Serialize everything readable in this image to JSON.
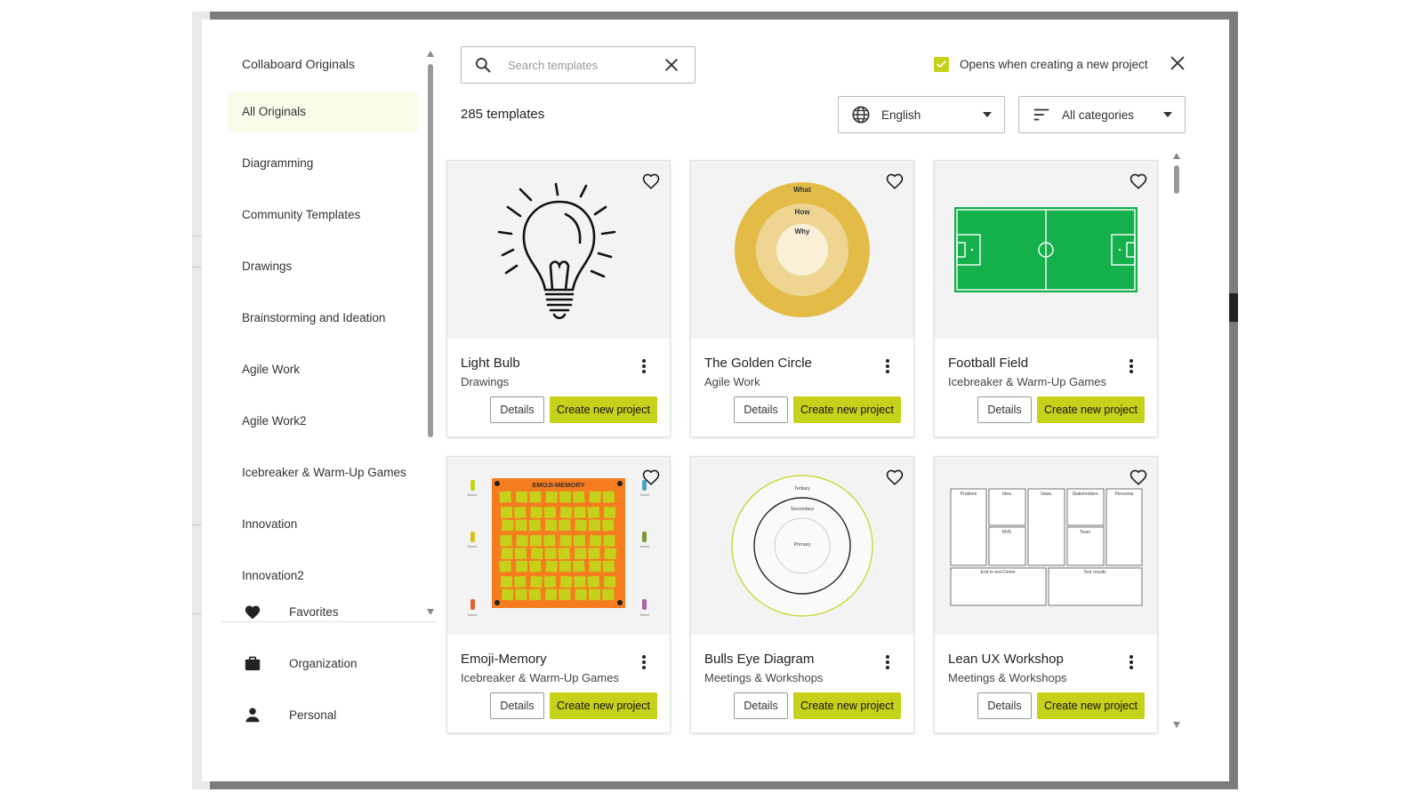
{
  "sidebar": {
    "header": "Collaboard Originals",
    "items": [
      {
        "label": "All Originals",
        "active": true
      },
      {
        "label": "Diagramming"
      },
      {
        "label": "Community Templates"
      },
      {
        "label": "Drawings"
      },
      {
        "label": "Brainstorming and Ideation"
      },
      {
        "label": "Agile Work"
      },
      {
        "label": "Agile Work2"
      },
      {
        "label": "Icebreaker & Warm-Up Games"
      },
      {
        "label": "Innovation"
      },
      {
        "label": "Innovation2"
      }
    ],
    "bottom": [
      {
        "label": "Favorites",
        "icon": "heart-icon"
      },
      {
        "label": "Organization",
        "icon": "briefcase-icon"
      },
      {
        "label": "Personal",
        "icon": "person-icon"
      }
    ]
  },
  "search": {
    "placeholder": "Search templates",
    "value": ""
  },
  "opens_checkbox": {
    "label": "Opens when creating a new project",
    "checked": true
  },
  "count_label": "285 templates",
  "language_select": {
    "value": "English",
    "icon": "globe-icon"
  },
  "category_select": {
    "value": "All categories",
    "icon": "filter-icon"
  },
  "accent_color": "#c5d11a",
  "card_buttons": {
    "details": "Details",
    "create": "Create new project"
  },
  "cards": [
    {
      "title": "Light Bulb",
      "category": "Drawings",
      "thumb": "lightbulb"
    },
    {
      "title": "The Golden Circle",
      "category": "Agile Work",
      "thumb": "golden-circle",
      "labels": [
        "What",
        "How",
        "Why"
      ]
    },
    {
      "title": "Football Field",
      "category": "Icebreaker & Warm-Up Games",
      "thumb": "football-field"
    },
    {
      "title": "Emoji-Memory",
      "category": "Icebreaker & Warm-Up Games",
      "thumb": "emoji-memory",
      "board_title": "EMOJI-MEMORY",
      "player_label": "Name"
    },
    {
      "title": "Bulls Eye Diagram",
      "category": "Meetings & Workshops",
      "thumb": "bulls-eye",
      "labels": [
        "Tertiary",
        "Secondary",
        "Primary"
      ]
    },
    {
      "title": "Lean UX Workshop",
      "category": "Meetings & Workshops",
      "thumb": "lean-ux",
      "labels": [
        "Problem",
        "Idea",
        "Value",
        "Stakeholders",
        "Personas",
        "MVE",
        "Team",
        "End to end Demo",
        "Test results"
      ]
    }
  ]
}
